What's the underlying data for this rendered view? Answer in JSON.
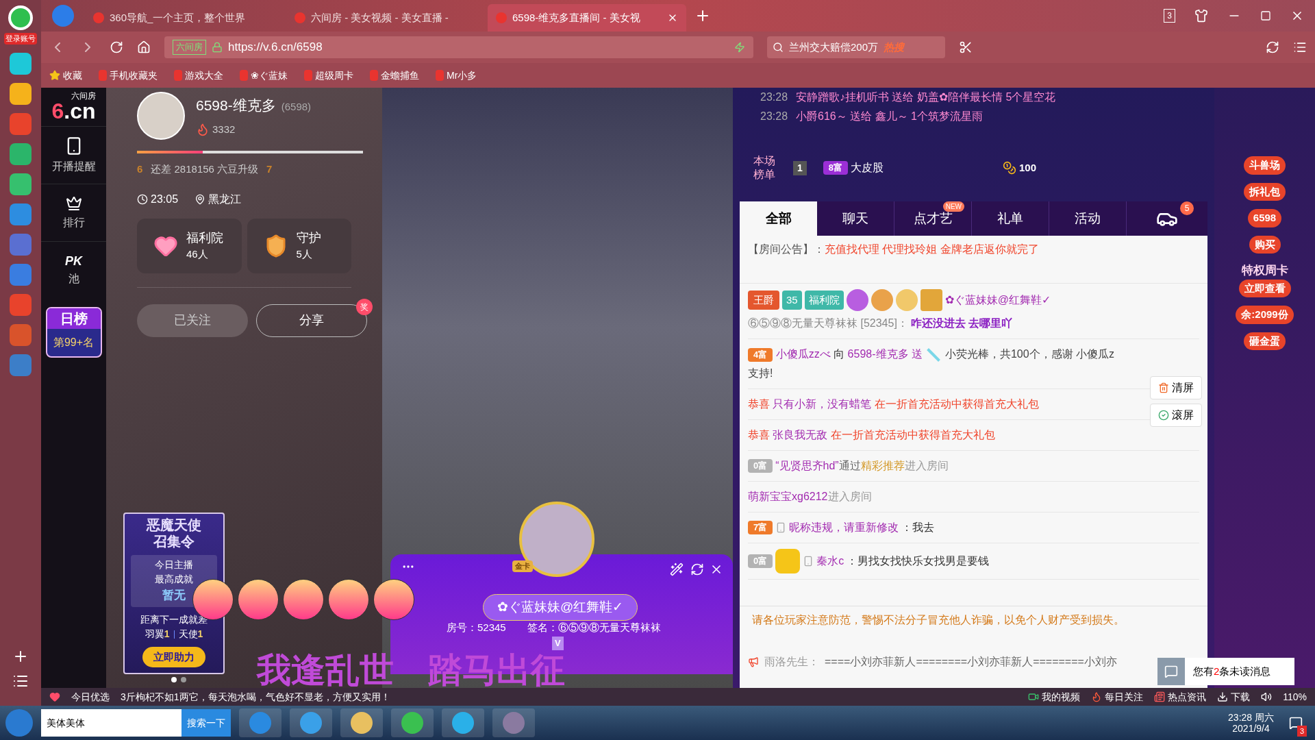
{
  "browser": {
    "rail_label": "登录账号",
    "tabs": [
      {
        "title": "360导航_一个主页，整个世界",
        "selected": false
      },
      {
        "title": "六间房 - 美女视频 - 美女直播 -",
        "selected": false
      },
      {
        "title": "6598-维克多直播间 - 美女视",
        "selected": true
      }
    ],
    "tab_count": "3",
    "url_prefix": "六间房",
    "url": "https://v.6.cn/6598",
    "search_value": "兰州交大赔偿200万",
    "search_badge": "热搜",
    "bookmarks": [
      "收藏",
      "手机收藏夹",
      "游戏大全",
      "❀ぐ蓝妹",
      "超级周卡",
      "金蟾捕鱼",
      "Mr小多"
    ]
  },
  "site_nav": {
    "logo_caption": "六间房",
    "logo": "6.cn",
    "items": [
      {
        "label": "开播提醒",
        "kind": "phone"
      },
      {
        "label": "排行",
        "kind": "crown"
      },
      {
        "label": "池",
        "kind": "pk",
        "mark": "PK"
      }
    ],
    "rank": {
      "title": "日榜",
      "value": "第99+名"
    }
  },
  "anchor": {
    "name": "6598-维克多",
    "room_id": "(6598)",
    "heat": "3332",
    "level": 0.29,
    "level_from": "6",
    "level_to": "7",
    "upgrade_text": "还差 2818156 六豆升级",
    "time": "23:05",
    "location": "黑龙江",
    "cards": [
      {
        "title": "福利院",
        "count": "46人",
        "kind": "heart"
      },
      {
        "title": "守护",
        "count": "5人",
        "kind": "shield"
      }
    ],
    "buttons": [
      {
        "label": "已关注",
        "kind": "followed"
      },
      {
        "label": "分享",
        "kind": "share",
        "badge": "奖"
      }
    ],
    "promo": {
      "title_1": "恶魔天使",
      "title_2": "召集令",
      "line_1": "今日主播",
      "line_2": "最高成就",
      "value": "暂无",
      "line_3": "距离下一成就差",
      "need_1_label": "羽翼",
      "need_1": "1",
      "need_2_label": "天使",
      "need_2": "1",
      "button": "立即助力"
    },
    "carousel": [
      {
        "selected": true
      },
      {
        "selected": false
      }
    ]
  },
  "video": {
    "caption": "我逢乱世　踏马出征",
    "card": {
      "name": "✿ぐ蓝妹妹@红舞鞋✓",
      "room": "房号：52345",
      "signature": "签名：⑥⑤⑨⑧无量天尊袜袜",
      "badge": "V",
      "avatar_tag": "金卡"
    }
  },
  "chat": {
    "ticker": [
      {
        "time": "23:28",
        "text": "安静蹭歌♪挂机听书 送给 奶盖✿陪伴最长情 5个星空花"
      },
      {
        "time": "23:28",
        "text": "小爵616～ 送给 鑫儿～ 1个筑梦流星雨"
      }
    ],
    "board": {
      "label": "本场榜单",
      "rank": "1",
      "rich": "8富",
      "name": "大皮股",
      "coins": "100"
    },
    "tabs": [
      {
        "label": "全部",
        "selected": true
      },
      {
        "label": "聊天",
        "selected": false
      },
      {
        "label": "点才艺",
        "selected": false,
        "badge": "NEW"
      },
      {
        "label": "礼单",
        "selected": false
      },
      {
        "label": "活动",
        "selected": false
      }
    ],
    "car_count": "5",
    "notice": {
      "label": "【房间公告】：",
      "text": "充值找代理 代理找玲姐 金牌老店返你就完了"
    },
    "messages": [
      {
        "kind": "user",
        "badges": [
          "王爵",
          "35",
          "福利院"
        ],
        "name": "✿ぐ蓝妹妹@红舞鞋✓",
        "meta": "⑥⑤⑨⑧无量天尊袜袜 [52345]：",
        "text": "咋还没进去 去哪里吖"
      },
      {
        "kind": "gift",
        "rich": "4富",
        "name": "小傻瓜zzべ",
        "text": "向",
        "target": "6598-维克多 送",
        "gift": "小荧光棒，共100个，感谢 小傻瓜z",
        "tail": "支持!"
      },
      {
        "kind": "congrats",
        "prefix": "恭喜",
        "name": "只有小新，没有蜡笔",
        "text": "在一折首充活动中获得首充大礼包"
      },
      {
        "kind": "congrats",
        "prefix": "恭喜",
        "name": "张良我无敌",
        "text": "在一折首充活动中获得首充大礼包"
      },
      {
        "kind": "enter",
        "rich": "0富",
        "name": "“见贤思齐hd”",
        "text": "通过",
        "highlight": "精彩推荐",
        "tail": "进入房间"
      },
      {
        "kind": "enter",
        "name": "萌新宝宝xg6212",
        "tail": "进入房间"
      },
      {
        "kind": "chat",
        "rich": "7富",
        "name": "昵称违规，请重新修改",
        "text": "：我去"
      },
      {
        "kind": "chat",
        "rich": "0富",
        "medal": true,
        "name": "秦水c",
        "text": "：男找女找快乐女找男是要钱"
      }
    ],
    "clear_button": "清屏",
    "scroll_button": "滚屏",
    "warning": "请各位玩家注意防范，警惕不法分子冒充他人诈骗，以免个人财产受到损失。",
    "broadcast": {
      "name": "雨洛先生：",
      "text": "====小刘亦菲新人========小刘亦菲新人========小刘亦"
    }
  },
  "side_strip": [
    {
      "label": "斗兽场"
    },
    {
      "label": "拆礼包"
    },
    {
      "label": "6598"
    },
    {
      "label": "购买"
    },
    {
      "label": "立即查看",
      "title": "特权周卡"
    },
    {
      "label": "余:2099份"
    },
    {
      "label": "砸金蛋"
    }
  ],
  "unread": {
    "prefix": "您有",
    "count": "2",
    "suffix": "条未读消息"
  },
  "status_bar": {
    "left": "今日优选",
    "news": "3斤枸杞不如1两它，每天泡水喝，气色好不显老，方便又实用！",
    "items": [
      "我的视频",
      "每日关注",
      "热点资讯",
      "下载"
    ],
    "zoom": "110%"
  },
  "taskbar": {
    "search_value": "美体美体",
    "search_button": "搜索一下",
    "time": "23:28 周六",
    "date": "2021/9/4",
    "notifications": "3"
  }
}
